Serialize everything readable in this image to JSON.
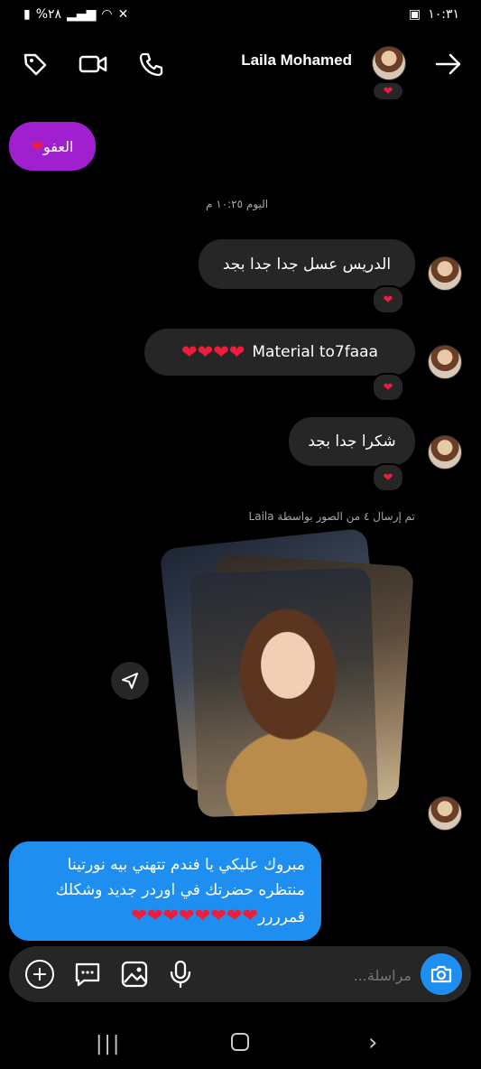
{
  "status": {
    "time": "١٠:٣١",
    "battery": "%٢٨"
  },
  "header": {
    "name": "Laila Mohamed",
    "icons": [
      "tag-icon",
      "video-call-icon",
      "phone-icon",
      "forward-arrow-icon"
    ]
  },
  "messages": {
    "purple_reply": "العفو",
    "timestamp": "اليوم ١٠:٢٥ م",
    "msg1": "الدريس عسل جدا جدا بجد",
    "msg2": "Material to7faaa",
    "msg3": "شكرا جدا بجد",
    "photo_note": "تم إرسال ٤ من الصور بواسطة Laila",
    "blue_message": "مبروك عليكي يا فندم تتهني بيه نورتينا منتظره حضرتك في اوردر جديد وشكلك قمرررر"
  },
  "composer": {
    "placeholder": "مراسلة..."
  },
  "colors": {
    "background": "#000000",
    "bubble": "#262626",
    "purple": "#a020d0",
    "blue": "#1f8ef1",
    "heart": "#ed1d3b"
  }
}
